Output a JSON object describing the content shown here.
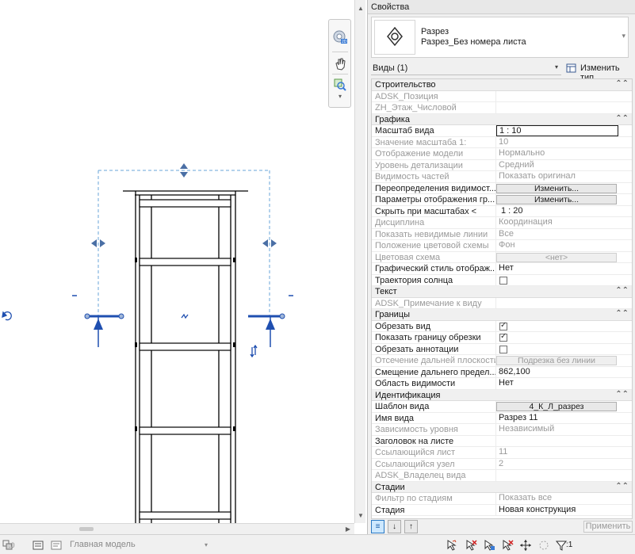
{
  "canvas": {
    "icons": [
      "nav-wheel-icon",
      "pan-icon",
      "zoom-icon",
      "chevron-down-icon"
    ]
  },
  "statusbar": {
    "coord_left": ":0",
    "model_name": "Главная модель",
    "filter_count": ":1"
  },
  "properties": {
    "title": "Свойства",
    "type_line1": "Разрез",
    "type_line2": "Разрез_Без номера листа",
    "selector": "Виды (1)",
    "edit_type": "Изменить тип",
    "apply": "Применить",
    "categories": {
      "construction": "Строительство",
      "graphics": "Графика",
      "text": "Текст",
      "extents": "Границы",
      "identity": "Идентификация",
      "phasing": "Стадии"
    },
    "rows": {
      "adsk_position": {
        "k": "ADSK_Позиция",
        "v": ""
      },
      "zh_floor": {
        "k": "ZH_Этаж_Числовой",
        "v": ""
      },
      "view_scale": {
        "k": "Масштаб вида",
        "v": "1 : 10"
      },
      "scale_value": {
        "k": "Значение масштаба    1:",
        "v": "10"
      },
      "model_display": {
        "k": "Отображение модели",
        "v": "Нормально"
      },
      "detail_level": {
        "k": "Уровень детализации",
        "v": "Средний"
      },
      "parts_visibility": {
        "k": "Видимость частей",
        "v": "Показать оригинал"
      },
      "vg_overrides": {
        "k": "Переопределения видимост...",
        "v": "Изменить..."
      },
      "graphic_display": {
        "k": "Параметры отображения гр...",
        "v": "Изменить..."
      },
      "hide_at_scales": {
        "k": "Скрыть при масштабах <",
        "v": "1 : 20"
      },
      "discipline": {
        "k": "Дисциплина",
        "v": "Координация"
      },
      "show_hidden": {
        "k": "Показать невидимые линии",
        "v": "Все"
      },
      "color_scheme_loc": {
        "k": "Положение цветовой схемы",
        "v": "Фон"
      },
      "color_scheme": {
        "k": "Цветовая схема",
        "v": "<нет>"
      },
      "graphic_style": {
        "k": "Графический стиль отображ...",
        "v": "Нет"
      },
      "sun_path": {
        "k": "Траектория солнца",
        "v": ""
      },
      "adsk_note": {
        "k": "ADSK_Примечание к виду",
        "v": ""
      },
      "crop_view": {
        "k": "Обрезать вид",
        "v": ""
      },
      "crop_visible": {
        "k": "Показать границу обрезки",
        "v": ""
      },
      "annotation_crop": {
        "k": "Обрезать аннотации",
        "v": ""
      },
      "far_clipping": {
        "k": "Отсечение дальней плоскости",
        "v": "Подрезка без линии"
      },
      "far_clip_offset": {
        "k": "Смещение дальнего предел...",
        "v": "862,100"
      },
      "scope_box": {
        "k": "Область видимости",
        "v": "Нет"
      },
      "view_template": {
        "k": "Шаблон вида",
        "v": "4_К_Л_разрез"
      },
      "view_name": {
        "k": "Имя вида",
        "v": "Разрез 11"
      },
      "dependency": {
        "k": "Зависимость уровня",
        "v": "Независимый"
      },
      "title_on_sheet": {
        "k": "Заголовок на листе",
        "v": ""
      },
      "ref_sheet": {
        "k": "Ссылающийся лист",
        "v": "11"
      },
      "ref_detail": {
        "k": "Ссылающийся узел",
        "v": "2"
      },
      "adsk_owner": {
        "k": "ADSK_Владелец вида",
        "v": ""
      },
      "phase_filter": {
        "k": "Фильтр по стадиям",
        "v": "Показать все"
      },
      "phase": {
        "k": "Стадия",
        "v": "Новая конструкция"
      }
    },
    "checkboxes": {
      "sun_path": false,
      "crop_view": true,
      "crop_visible": true,
      "annotation_crop": false
    }
  }
}
